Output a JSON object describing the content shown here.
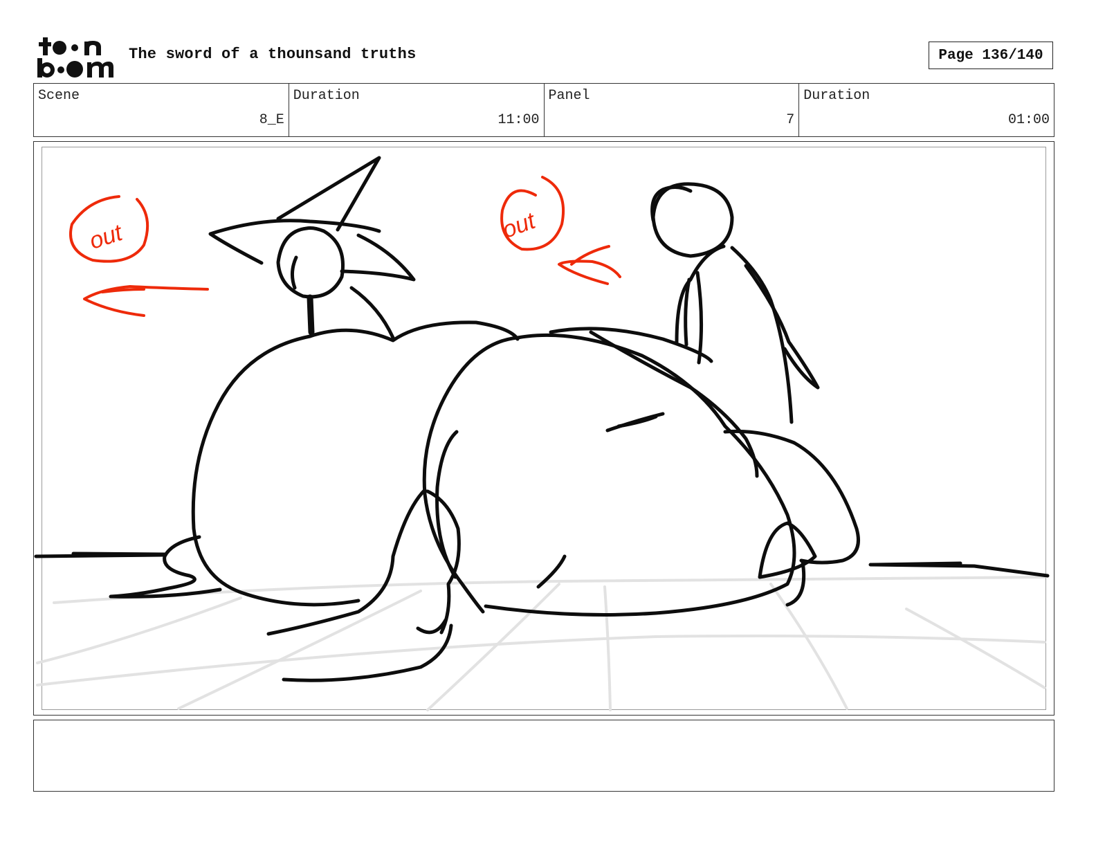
{
  "header": {
    "logo_text": "toon boom",
    "title": "The sword of a thounsand truths",
    "page_label": "Page 136/140"
  },
  "info_bar": [
    {
      "label": "Scene",
      "value": "8_E"
    },
    {
      "label": "Duration",
      "value": "11:00"
    },
    {
      "label": "Panel",
      "value": "7"
    },
    {
      "label": "Duration",
      "value": "01:00"
    }
  ],
  "panel": {
    "annotations": [
      {
        "text": "out",
        "color": "#ee2a0a"
      },
      {
        "text": "out",
        "color": "#ee2a0a"
      }
    ]
  },
  "notes": {
    "text": ""
  }
}
